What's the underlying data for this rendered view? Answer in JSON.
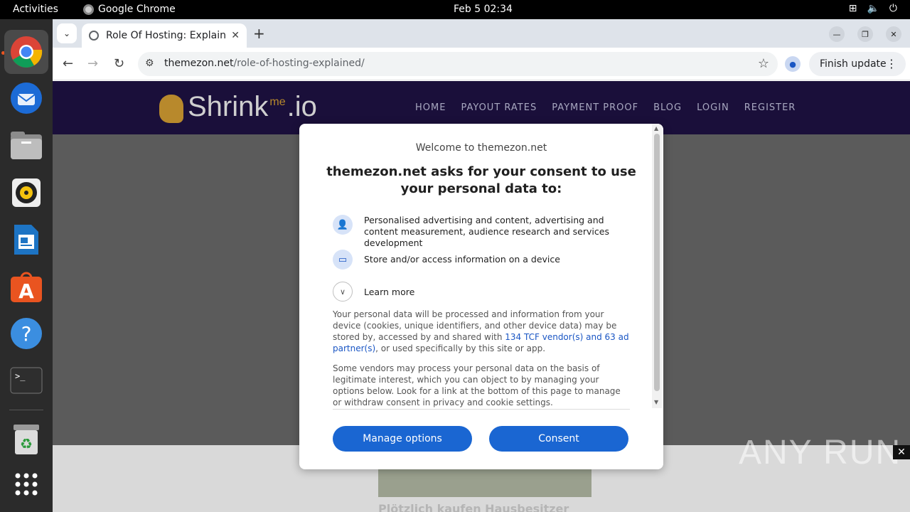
{
  "topbar": {
    "activities": "Activities",
    "app_name": "Google Chrome",
    "clock": "Feb 5  02:34"
  },
  "dock": {
    "items": [
      "chrome-icon",
      "thunderbird-icon",
      "files-icon",
      "rhythmbox-icon",
      "writer-icon",
      "app-center-icon",
      "help-icon",
      "terminal-icon",
      "trash-icon",
      "app-grid-icon"
    ]
  },
  "browser": {
    "tab_title": "Role Of Hosting: Explained",
    "url_domain": "themezon.net",
    "url_path": "/role-of-hosting-explained/",
    "finish_update": "Finish update"
  },
  "site": {
    "logo_text": "Shrink",
    "logo_me": "me",
    "logo_suffix": ".io",
    "nav": [
      "HOME",
      "PAYOUT RATES",
      "PAYMENT PROOF",
      "BLOG",
      "LOGIN",
      "REGISTER"
    ],
    "ad_headline": "Plötzlich kaufen Hausbesitzer",
    "watermark": "ANY RUN"
  },
  "consent": {
    "welcome": "Welcome to themezon.net",
    "heading": "themezon.net asks for your consent to use your personal data to:",
    "purposes": [
      "Personalised advertising and content, advertising and content measurement, audience research and services development",
      "Store and/or access information on a device"
    ],
    "learn_more": "Learn more",
    "para1_before": "Your personal data will be processed and information from your device (cookies, unique identifiers, and other device data) may be stored by, accessed by and shared with ",
    "para1_link": "134 TCF vendor(s) and 63 ad partner(s)",
    "para1_after": ", or used specifically by this site or app.",
    "para2": "Some vendors may process your personal data on the basis of legitimate interest, which you can object to by managing your options below. Look for a link at the bottom of this page to manage or withdraw consent in privacy and cookie settings.",
    "manage_label": "Manage options",
    "consent_label": "Consent"
  }
}
